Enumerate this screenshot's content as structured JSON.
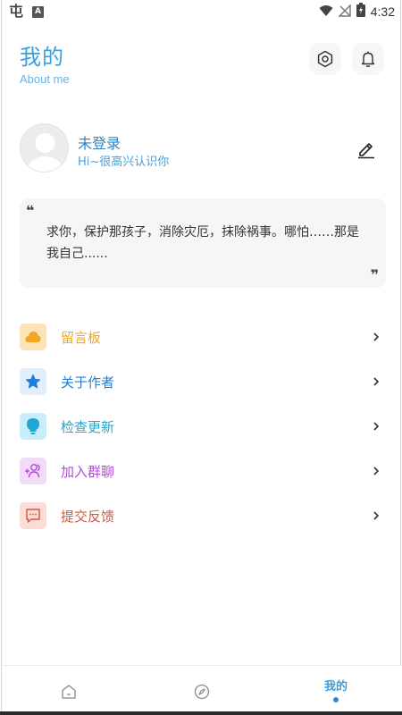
{
  "status_bar": {
    "time": "4:32",
    "icons": [
      "app-icon",
      "a-notification-icon",
      "wifi-icon",
      "no-signal-icon",
      "battery-charging-icon"
    ]
  },
  "header": {
    "title": "我的",
    "subtitle": "About me",
    "buttons": [
      "settings-icon",
      "bell-icon"
    ]
  },
  "profile": {
    "name": "未登录",
    "greeting": "Hi~很高兴认识你"
  },
  "quote": {
    "open_mark": "❝",
    "close_mark": "❞",
    "text": "求你，保护那孩子，消除灾厄，抹除祸事。哪怕……那是我自己......"
  },
  "menu": {
    "items": [
      {
        "label": "留言板",
        "icon": "cloud-icon",
        "color": "#f0a623",
        "bg": "#fde4b8"
      },
      {
        "label": "关于作者",
        "icon": "star-icon",
        "color": "#1f7fd8",
        "bg": "#e1eefc"
      },
      {
        "label": "检查更新",
        "icon": "lightbulb-icon",
        "color": "#23a6cf",
        "bg": "#c9eefb"
      },
      {
        "label": "加入群聊",
        "icon": "add-group-icon",
        "color": "#b54ad6",
        "bg": "#f0dcf6"
      },
      {
        "label": "提交反馈",
        "icon": "message-icon",
        "color": "#d5573e",
        "bg": "#fbdcd6"
      }
    ]
  },
  "bottom_nav": {
    "tabs": [
      {
        "icon": "home-icon"
      },
      {
        "icon": "compass-icon"
      },
      {
        "label": "我的",
        "active": true
      }
    ]
  }
}
